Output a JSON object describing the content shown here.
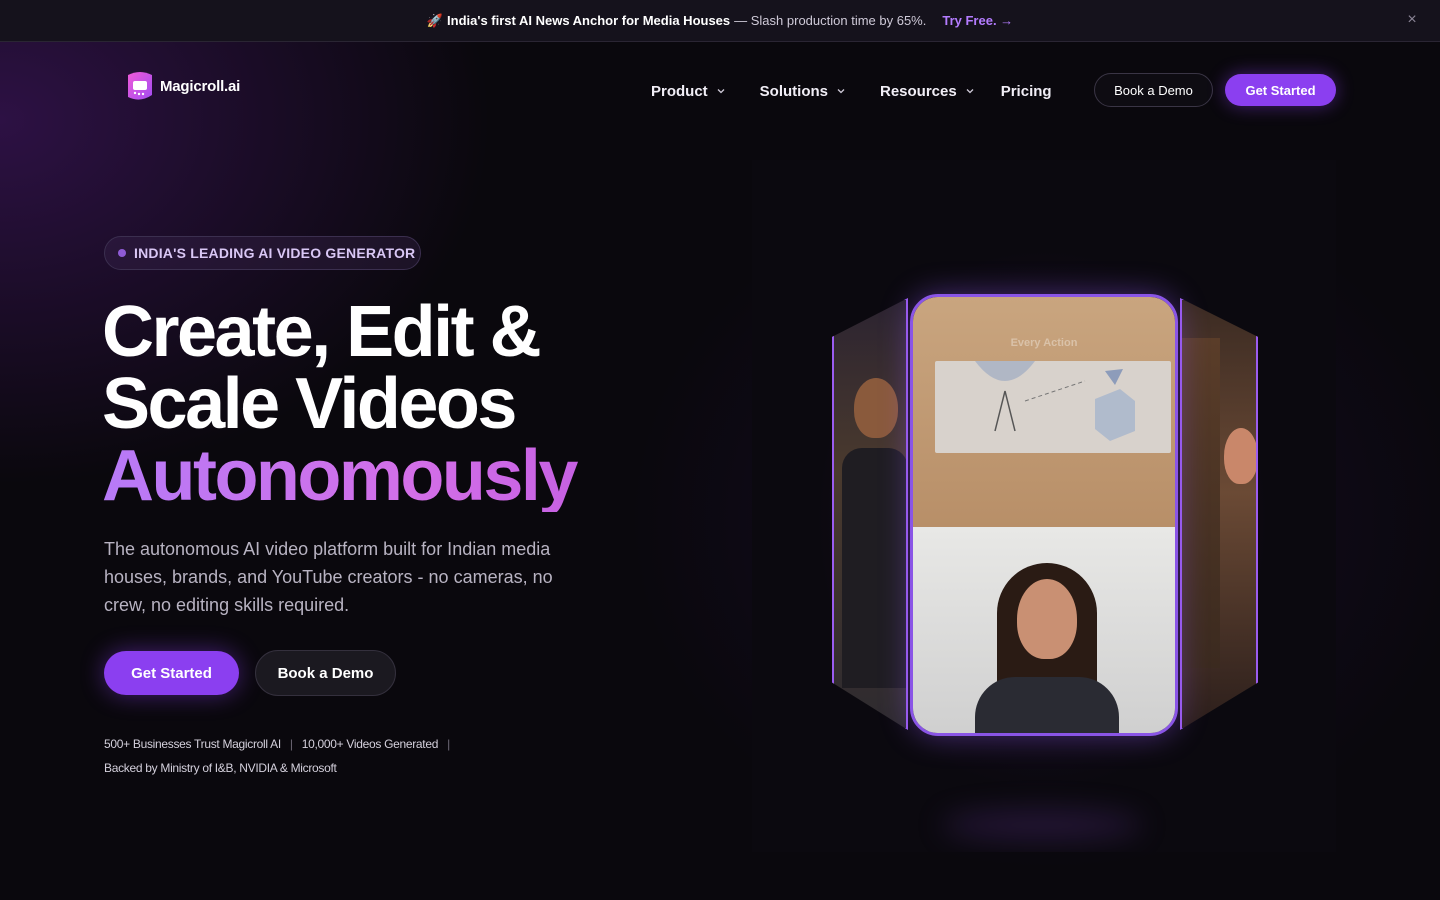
{
  "announcement": {
    "emoji": "🚀",
    "highlight": "India's first AI News Anchor for Media Houses",
    "rest": "— Slash production time by 65%.",
    "cta": "Try Free. →",
    "close_label": "×"
  },
  "logo": {
    "text": "Magicroll.ai"
  },
  "nav": {
    "items": [
      {
        "label": "Product",
        "has_dropdown": true
      },
      {
        "label": "Solutions",
        "has_dropdown": true
      },
      {
        "label": "Resources",
        "has_dropdown": true
      },
      {
        "label": "Pricing",
        "has_dropdown": false
      }
    ],
    "book_demo": "Book a Demo",
    "get_started": "Get Started"
  },
  "hero": {
    "badge": "INDIA'S LEADING AI VIDEO GENERATOR",
    "headline_line1": "Create, Edit &",
    "headline_line2": "Scale Videos",
    "headline_accent": "Autonomously",
    "subtext": "The autonomous AI video platform built for Indian media houses, brands, and YouTube creators - no cameras, no crew, no editing skills required.",
    "primary_cta": "Get Started",
    "secondary_cta": "Book a Demo",
    "stats": [
      "500+ Businesses Trust Magicroll AI",
      "10,000+ Videos Generated"
    ],
    "backed_by": "Backed by Ministry of I&B, NVIDIA & Microsoft",
    "video_caption": "Every Action"
  },
  "colors": {
    "accent": "#8b3ff0",
    "accent_gradient_start": "#b77af7",
    "accent_gradient_end": "#c05ae0",
    "background": "#0a080d"
  }
}
